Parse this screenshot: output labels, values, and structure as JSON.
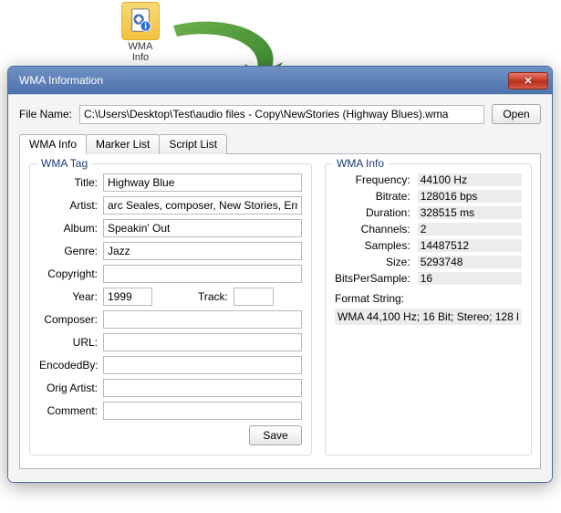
{
  "desktop_icon": {
    "label_line1": "WMA",
    "label_line2": "Info"
  },
  "dialog": {
    "title": "WMA Information",
    "close_glyph": "✕"
  },
  "filerow": {
    "label": "File Name:",
    "value": "C:\\Users\\Desktop\\Test\\audio files - Copy\\NewStories (Highway Blues).wma",
    "open_label": "Open"
  },
  "tabs": {
    "wma_info": "WMA Info",
    "marker_list": "Marker List",
    "script_list": "Script List"
  },
  "tag_group": {
    "legend": "WMA Tag",
    "labels": {
      "title": "Title:",
      "artist": "Artist:",
      "album": "Album:",
      "genre": "Genre:",
      "copyright": "Copyright:",
      "year": "Year:",
      "track": "Track:",
      "composer": "Composer:",
      "url": "URL:",
      "encodedby": "EncodedBy:",
      "orig_artist": "Orig Artist:",
      "comment": "Comment:"
    },
    "values": {
      "title": "Highway Blue",
      "artist": "arc Seales, composer, New Stories, Ernie Wa",
      "album": "Speakin' Out",
      "genre": "Jazz",
      "copyright": "",
      "year": "1999",
      "track": "",
      "composer": "",
      "url": "",
      "encodedby": "",
      "orig_artist": "",
      "comment": ""
    },
    "save_label": "Save"
  },
  "info_group": {
    "legend": "WMA Info",
    "rows": {
      "frequency": {
        "label": "Frequency:",
        "value": "44100 Hz"
      },
      "bitrate": {
        "label": "Bitrate:",
        "value": "128016 bps"
      },
      "duration": {
        "label": "Duration:",
        "value": "328515 ms"
      },
      "channels": {
        "label": "Channels:",
        "value": "2"
      },
      "samples": {
        "label": "Samples:",
        "value": "14487512"
      },
      "size": {
        "label": "Size:",
        "value": "5293748"
      },
      "bps": {
        "label": "BitsPerSample:",
        "value": "16"
      }
    },
    "format_label": "Format String:",
    "format_value": "WMA 44,100 Hz; 16 Bit; Stereo; 128 l"
  }
}
